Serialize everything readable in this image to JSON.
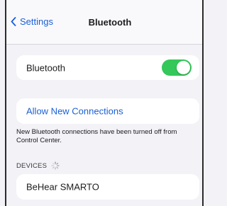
{
  "nav": {
    "back_label": "Settings",
    "title": "Bluetooth"
  },
  "bluetooth_row": {
    "label": "Bluetooth",
    "toggle_on": true,
    "toggle_color": "#34c759"
  },
  "allow_row": {
    "label": "Allow New Connections"
  },
  "footnote": "New Bluetooth connections have been turned off from Control Center.",
  "devices_section": {
    "header": "DEVICES",
    "loading_icon": "spinner-icon",
    "devices": [
      {
        "name": "BeHear SMARTO"
      }
    ]
  },
  "colors": {
    "accent": "#1a5fd6",
    "background": "#f2f2f7",
    "card": "#ffffff"
  }
}
